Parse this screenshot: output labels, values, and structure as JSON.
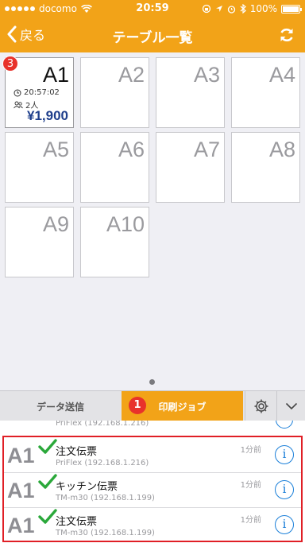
{
  "status_bar": {
    "carrier": "docomo",
    "time": "20:59",
    "battery": "100%"
  },
  "nav": {
    "back_label": "戻る",
    "title": "テーブル一覧"
  },
  "tables": [
    {
      "name": "A1",
      "badge": "3",
      "time": "20:57:02",
      "guests": "2人",
      "amount": "¥1,900"
    },
    {
      "name": "A2"
    },
    {
      "name": "A3"
    },
    {
      "name": "A4"
    },
    {
      "name": "A5"
    },
    {
      "name": "A6"
    },
    {
      "name": "A7"
    },
    {
      "name": "A8"
    },
    {
      "name": "A9"
    },
    {
      "name": "A10"
    }
  ],
  "tabs": {
    "send_label": "データ送信",
    "print_label": "印刷ジョブ",
    "print_badge": "1"
  },
  "partial_job": {
    "printer": "PriFlex (192.168.1.216)"
  },
  "jobs": [
    {
      "table": "A1",
      "title": "注文伝票",
      "printer": "PriFlex (192.168.1.216)",
      "time": "1分前"
    },
    {
      "table": "A1",
      "title": "キッチン伝票",
      "printer": "TM-m30 (192.168.1.199)",
      "time": "1分前"
    },
    {
      "table": "A1",
      "title": "注文伝票",
      "printer": "TM-m30 (192.168.1.199)",
      "time": "1分前"
    }
  ],
  "colors": {
    "accent": "#f2a318",
    "badge": "#e8322b",
    "price": "#1f3f8c",
    "info": "#1a7fd9"
  }
}
